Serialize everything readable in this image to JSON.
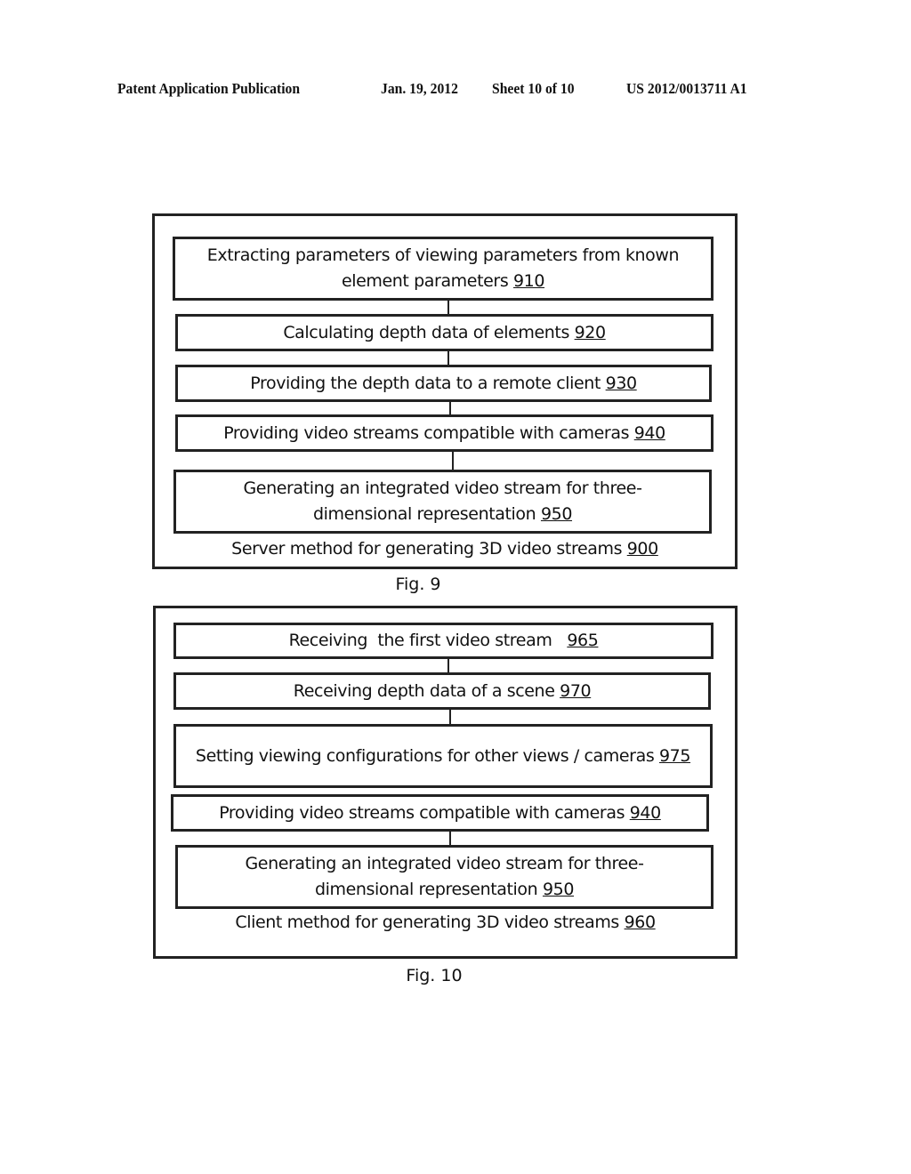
{
  "header": {
    "publication": "Patent Application Publication",
    "date": "Jan. 19, 2012",
    "sheet": "Sheet 10 of 10",
    "number": "US 2012/0013711 A1"
  },
  "fig9": {
    "steps": [
      {
        "text": "Extracting parameters of viewing parameters from known element parameters ",
        "ref": "910"
      },
      {
        "text": "Calculating depth data of elements ",
        "ref": "920"
      },
      {
        "text": "Providing  the depth data to a remote client ",
        "ref": "930"
      },
      {
        "text": "Providing  video streams  compatible with cameras ",
        "ref": "940"
      },
      {
        "text": "Generating an integrated  video stream for three-dimensional representation ",
        "ref": "950"
      }
    ],
    "caption": {
      "text": "Server method for generating 3D video  streams ",
      "ref": "900"
    },
    "label": "Fig. 9"
  },
  "fig10": {
    "steps": [
      {
        "text": "Receiving  the first video stream   ",
        "ref": "965"
      },
      {
        "text": "Receiving depth data of a scene ",
        "ref": "970"
      },
      {
        "text": "Setting viewing configurations for other views / cameras ",
        "ref": "975"
      },
      {
        "text": "Providing  video streams  compatible with cameras ",
        "ref": "940"
      },
      {
        "text": "Generating an integrated  video stream for three-dimensional representation ",
        "ref": "950"
      }
    ],
    "caption": {
      "text": "Client method for generating 3D video  streams ",
      "ref": "960"
    },
    "label": "Fig. 10"
  }
}
